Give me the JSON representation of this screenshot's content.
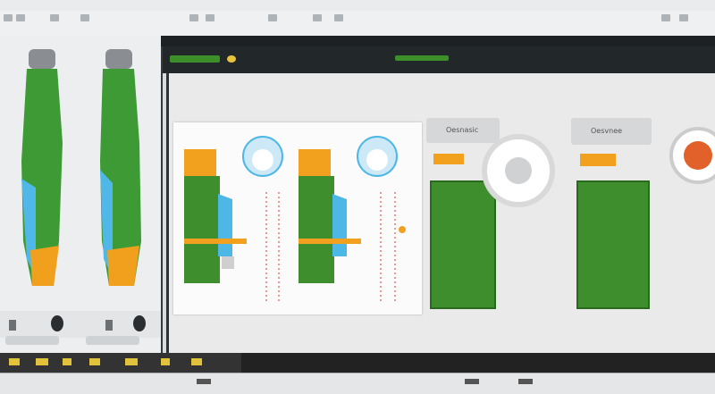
{
  "window": {
    "title_tabs": [
      "",
      "",
      "",
      ""
    ]
  },
  "menubar": {
    "items": [
      "",
      "",
      ""
    ]
  },
  "canvas": {
    "labels": [
      "Oesnasic",
      "Oesvnee"
    ]
  },
  "colors": {
    "green": "#3e8e2e",
    "orange": "#f2a11f",
    "blue": "#4db7e6",
    "dark": "#1d2124",
    "red": "#d13b2a"
  },
  "icons": [
    "probe-icon",
    "zoom-icon",
    "toolbar-icon"
  ]
}
